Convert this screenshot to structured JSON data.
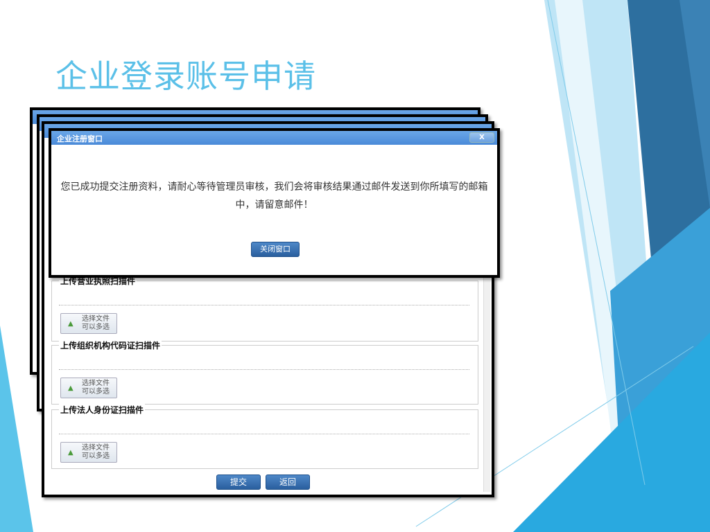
{
  "slide_title": "企业登录账号申请",
  "dialog": {
    "title": "企业注册窗口",
    "close": "X",
    "message": "您已成功提交注册资料，请耐心等待管理员审核，我们会将审核结果通过邮件发送到你所填写的邮箱中，请留意邮件！",
    "close_button": "关闭窗口"
  },
  "form": {
    "sections": [
      {
        "legend": "上传营业执照扫描件",
        "button": "选择文件\n可以多选"
      },
      {
        "legend": "上传组织机构代码证扫描件",
        "button": "选择文件\n可以多选"
      },
      {
        "legend": "上传法人身份证扫描件",
        "button": "选择文件\n可以多选"
      }
    ],
    "submit": "提交",
    "back": "返回"
  },
  "colors": {
    "accent": "#5bc0e8",
    "titlebar": "#4a8ad8"
  }
}
